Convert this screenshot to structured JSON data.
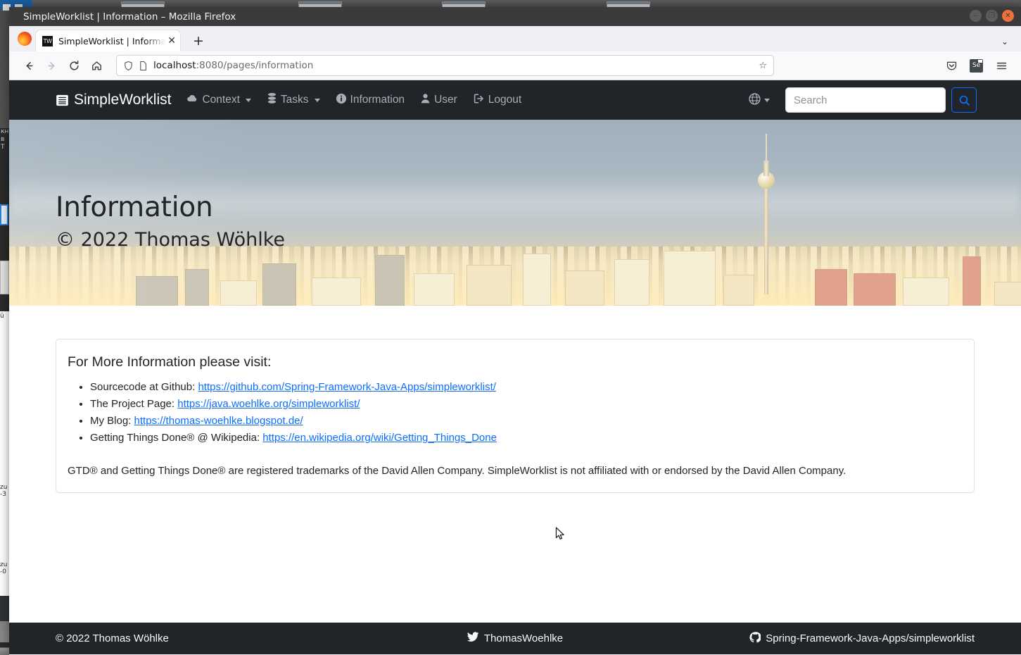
{
  "window": {
    "title": "SimpleWorklist | Information – Mozilla Firefox",
    "controls": {
      "minimize": "–",
      "maximize": "❐",
      "close": "✕"
    }
  },
  "browser": {
    "tab": {
      "favicon_label": "TW",
      "title": "SimpleWorklist | Informat",
      "close_label": "✕"
    },
    "new_tab_label": "+",
    "list_all_tabs_label": "⌄",
    "toolbar": {
      "back_label": "←",
      "forward_label": "→",
      "reload_label": "⟳",
      "home_label": "⌂",
      "url_host": "localhost",
      "url_path": ":8080/pages/information",
      "bookmark_label": "☆",
      "pocket_label": "pocket",
      "extension_label": "Se",
      "menu_label": "☰"
    }
  },
  "app": {
    "brand": "SimpleWorklist",
    "nav_items": [
      {
        "label": "Context",
        "icon": "cloud-icon",
        "has_caret": true
      },
      {
        "label": "Tasks",
        "icon": "database-icon",
        "has_caret": true
      },
      {
        "label": "Information",
        "icon": "info-circle-icon",
        "has_caret": false
      },
      {
        "label": "User",
        "icon": "person-icon",
        "has_caret": false
      },
      {
        "label": "Logout",
        "icon": "logout-icon",
        "has_caret": false
      }
    ],
    "language_switch": {
      "icon": "globe-icon",
      "has_caret": true
    },
    "search": {
      "placeholder": "Search",
      "value": "",
      "button_icon": "search-icon"
    }
  },
  "hero": {
    "title": "Information",
    "subtitle": "© 2022 Thomas Wöhlke",
    "image_alt": "berlin-skyline-photo"
  },
  "card": {
    "heading": "For More Information please visit:",
    "links": [
      {
        "prefix": "Sourcecode at Github: ",
        "link_text": "https://github.com/Spring-Framework-Java-Apps/simpleworklist/"
      },
      {
        "prefix": "The Project Page: ",
        "link_text": "https://java.woehlke.org/simpleworklist/"
      },
      {
        "prefix": "My Blog: ",
        "link_text": "https://thomas-woehlke.blogspot.de/"
      },
      {
        "prefix": "Getting Things Done® @ Wikipedia: ",
        "link_text": "https://en.wikipedia.org/wiki/Getting_Things_Done"
      }
    ],
    "trademark": "GTD® and Getting Things Done® are registered trademarks of the David Allen Company. SimpleWorklist is not affiliated with or endorsed by the David Allen Company."
  },
  "footer": {
    "copyright": "© 2022 Thomas Wöhlke",
    "twitter": "ThomasWoehlke",
    "github": "Spring-Framework-Java-Apps/simpleworklist"
  },
  "colors": {
    "navbar_bg": "#212529",
    "nav_link": "#a7aeb4",
    "accent_blue": "#0d6efd",
    "card_border": "#dfdfdf",
    "page_bg": "#ffffff"
  }
}
